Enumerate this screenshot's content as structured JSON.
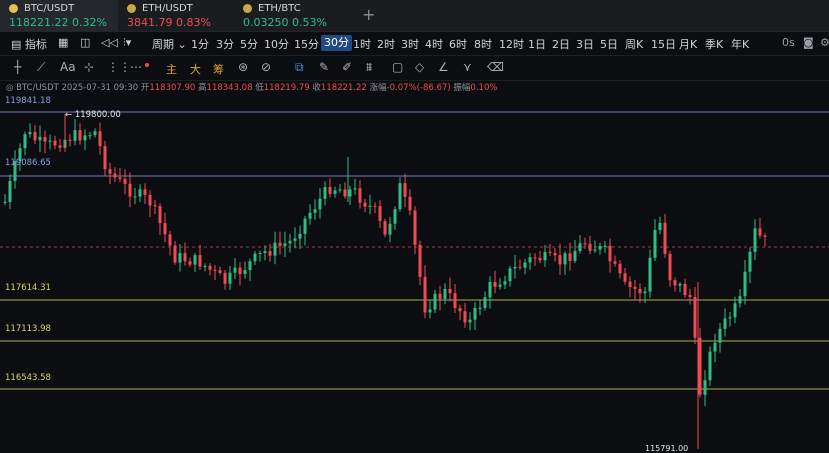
{
  "tabs": [
    {
      "symbol": "BTC/USDT",
      "price": "118221.22",
      "change": "0.32%",
      "dir": "up",
      "dot": "#e8c14a",
      "active": true
    },
    {
      "symbol": "ETH/USDT",
      "price": "3841.79",
      "change": "0.83%",
      "dir": "down",
      "dot": "#c9a845",
      "active": false
    },
    {
      "symbol": "ETH/BTC",
      "price": "0.03250",
      "change": "0.53%",
      "dir": "up",
      "dot": "#c9a845",
      "active": false
    }
  ],
  "new_tab_label": "+",
  "toolbar": {
    "indicator_label": "指标",
    "period_label": "周期",
    "intervals": [
      "1分",
      "3分",
      "5分",
      "10分",
      "15分",
      "30分",
      "1时",
      "2时",
      "3时",
      "4时",
      "6时",
      "8时",
      "12时",
      "1日",
      "2日",
      "3日",
      "5日",
      "周K",
      "15日",
      "月K",
      "季K",
      "年K"
    ],
    "selected_interval": "30分",
    "countdown": "0s"
  },
  "draw_toolbar": {
    "main_label": "主",
    "large_label": "大",
    "chip_label": "筹"
  },
  "ohlc": {
    "symbol": "BTC/USDT",
    "time": "2025-07-31 09:30",
    "open_label": "开",
    "open": "118307.90",
    "high_label": "高",
    "high": "118343.08",
    "low_label": "低",
    "low": "118219.79",
    "close_label": "收",
    "close": "118221.22",
    "change_label": "涨幅",
    "change": "-0.07%(-86.67)",
    "amplitude_label": "振幅",
    "amplitude": "0.10%"
  },
  "levels": [
    {
      "price": "119841.18",
      "color": "#8a9fe0"
    },
    {
      "price": "119086.65",
      "color": "#8a9fe0"
    },
    {
      "price": "117614.31",
      "color": "#d9d46a"
    },
    {
      "price": "117113.98",
      "color": "#d9d46a"
    },
    {
      "price": "116543.58",
      "color": "#d9d46a"
    }
  ],
  "high_marker": "← 119800.00",
  "low_marker": "115791.00",
  "colors": {
    "up": "#2ebd85",
    "down": "#f04b55",
    "background": "#0b0d10"
  }
}
